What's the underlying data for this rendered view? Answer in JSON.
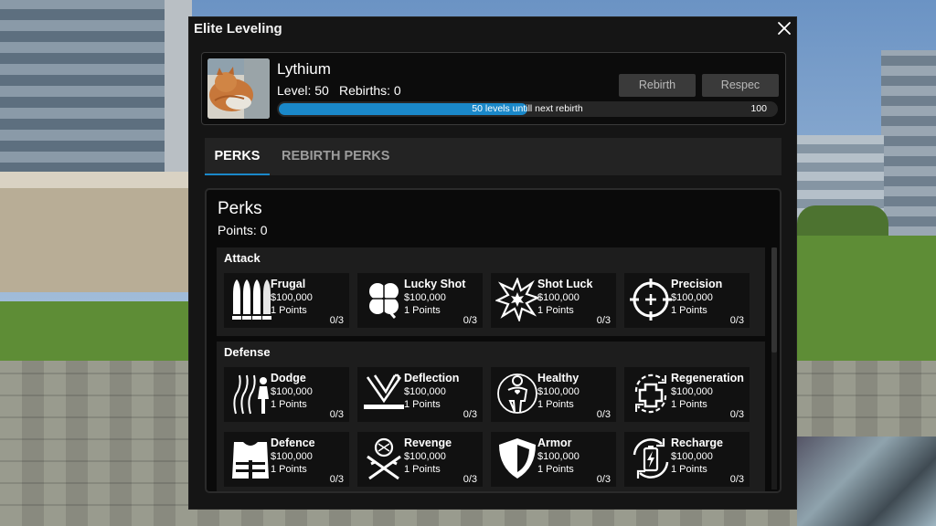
{
  "window": {
    "title": "Elite Leveling"
  },
  "player": {
    "name": "Lythium",
    "level_text": "Level: 50",
    "rebirths_text": "Rebirths: 0",
    "progress_text": "50 levels untill next rebirth",
    "progress_max": "100",
    "progress_fraction": 0.5
  },
  "buttons": {
    "rebirth": "Rebirth",
    "respec": "Respec"
  },
  "tabs": [
    {
      "label": "PERKS",
      "active": true
    },
    {
      "label": "REBIRTH PERKS",
      "active": false
    }
  ],
  "perks_panel": {
    "title": "Perks",
    "points": "Points: 0",
    "categories": [
      {
        "name": "Attack",
        "perks": [
          {
            "name": "Frugal",
            "price": "$100,000",
            "points": "1 Points",
            "count": "0/3",
            "icon": "bullets-icon"
          },
          {
            "name": "Lucky Shot",
            "price": "$100,000",
            "points": "1 Points",
            "count": "0/3",
            "icon": "clover-icon"
          },
          {
            "name": "Shot Luck",
            "price": "$100,000",
            "points": "1 Points",
            "count": "0/3",
            "icon": "burst-icon"
          },
          {
            "name": "Precision",
            "price": "$100,000",
            "points": "1 Points",
            "count": "0/3",
            "icon": "crosshair-icon"
          }
        ]
      },
      {
        "name": "Defense",
        "perks": [
          {
            "name": "Dodge",
            "price": "$100,000",
            "points": "1 Points",
            "count": "0/3",
            "icon": "dodge-icon"
          },
          {
            "name": "Deflection",
            "price": "$100,000",
            "points": "1 Points",
            "count": "0/3",
            "icon": "deflection-icon"
          },
          {
            "name": "Healthy",
            "price": "$100,000",
            "points": "1 Points",
            "count": "0/3",
            "icon": "healthy-body-icon"
          },
          {
            "name": "Regeneration",
            "price": "$100,000",
            "points": "1 Points",
            "count": "0/3",
            "icon": "regeneration-icon"
          },
          {
            "name": "Defence",
            "price": "$100,000",
            "points": "1 Points",
            "count": "0/3",
            "icon": "vest-icon"
          },
          {
            "name": "Revenge",
            "price": "$100,000",
            "points": "1 Points",
            "count": "0/3",
            "icon": "revenge-icon"
          },
          {
            "name": "Armor",
            "price": "$100,000",
            "points": "1 Points",
            "count": "0/3",
            "icon": "shield-icon"
          },
          {
            "name": "Recharge",
            "price": "$100,000",
            "points": "1 Points",
            "count": "0/3",
            "icon": "battery-recharge-icon"
          }
        ]
      }
    ]
  },
  "colors": {
    "accent": "#1a88c9",
    "window_bg": "#151515",
    "card_bg": "#111111"
  }
}
